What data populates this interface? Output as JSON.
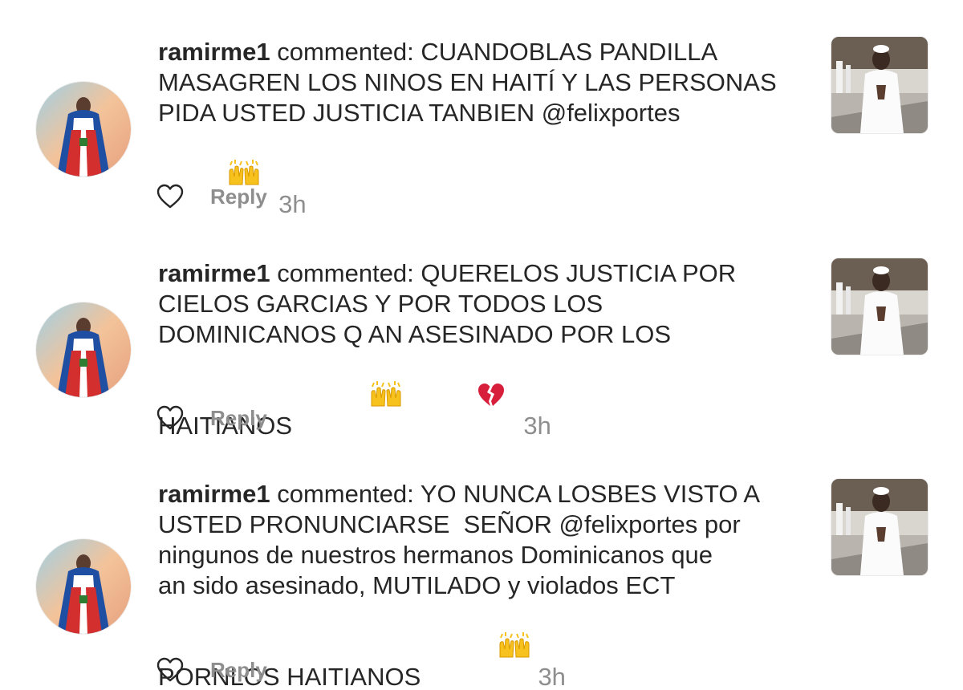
{
  "notifications": [
    {
      "username": "ramirme1",
      "lines": [
        " commented: CUANDOBLAS PANDILLA",
        "MASAGREN LOS NINOS EN HAITÍ Y LAS PERSONAS",
        "PIDA USTED JUSTICIA TANBIEN @felixportes"
      ],
      "emojis": [
        "raising-hands"
      ],
      "time": "3h",
      "reply_label": "Reply"
    },
    {
      "username": "ramirme1",
      "lines": [
        " commented: QUERELOS JUSTICIA POR",
        "CIELOS GARCIAS Y POR TODOS LOS",
        "DOMINICANOS Q AN ASESINADO POR LOS",
        "HAITIANOS"
      ],
      "emojis": [
        "raising-hands",
        "broken-heart"
      ],
      "time": "3h",
      "reply_label": "Reply"
    },
    {
      "username": "ramirme1",
      "lines": [
        " commented: YO NUNCA LOSBES VISTO A",
        "USTED PRONUNCIARSE  SEÑOR @felixportes por",
        "ningunos de nuestros hermanos Dominicanos que",
        "an sido asesinado, MUTILADO y violados ECT",
        "PORNLOS HAITIANOS"
      ],
      "emojis": [
        "raising-hands"
      ],
      "time": "3h",
      "reply_label": "Reply"
    }
  ],
  "colors": {
    "text": "#262626",
    "secondary": "#8e8e8e",
    "emoji_yellow": "#f7c21d",
    "broken_heart": "#d71f3b"
  }
}
